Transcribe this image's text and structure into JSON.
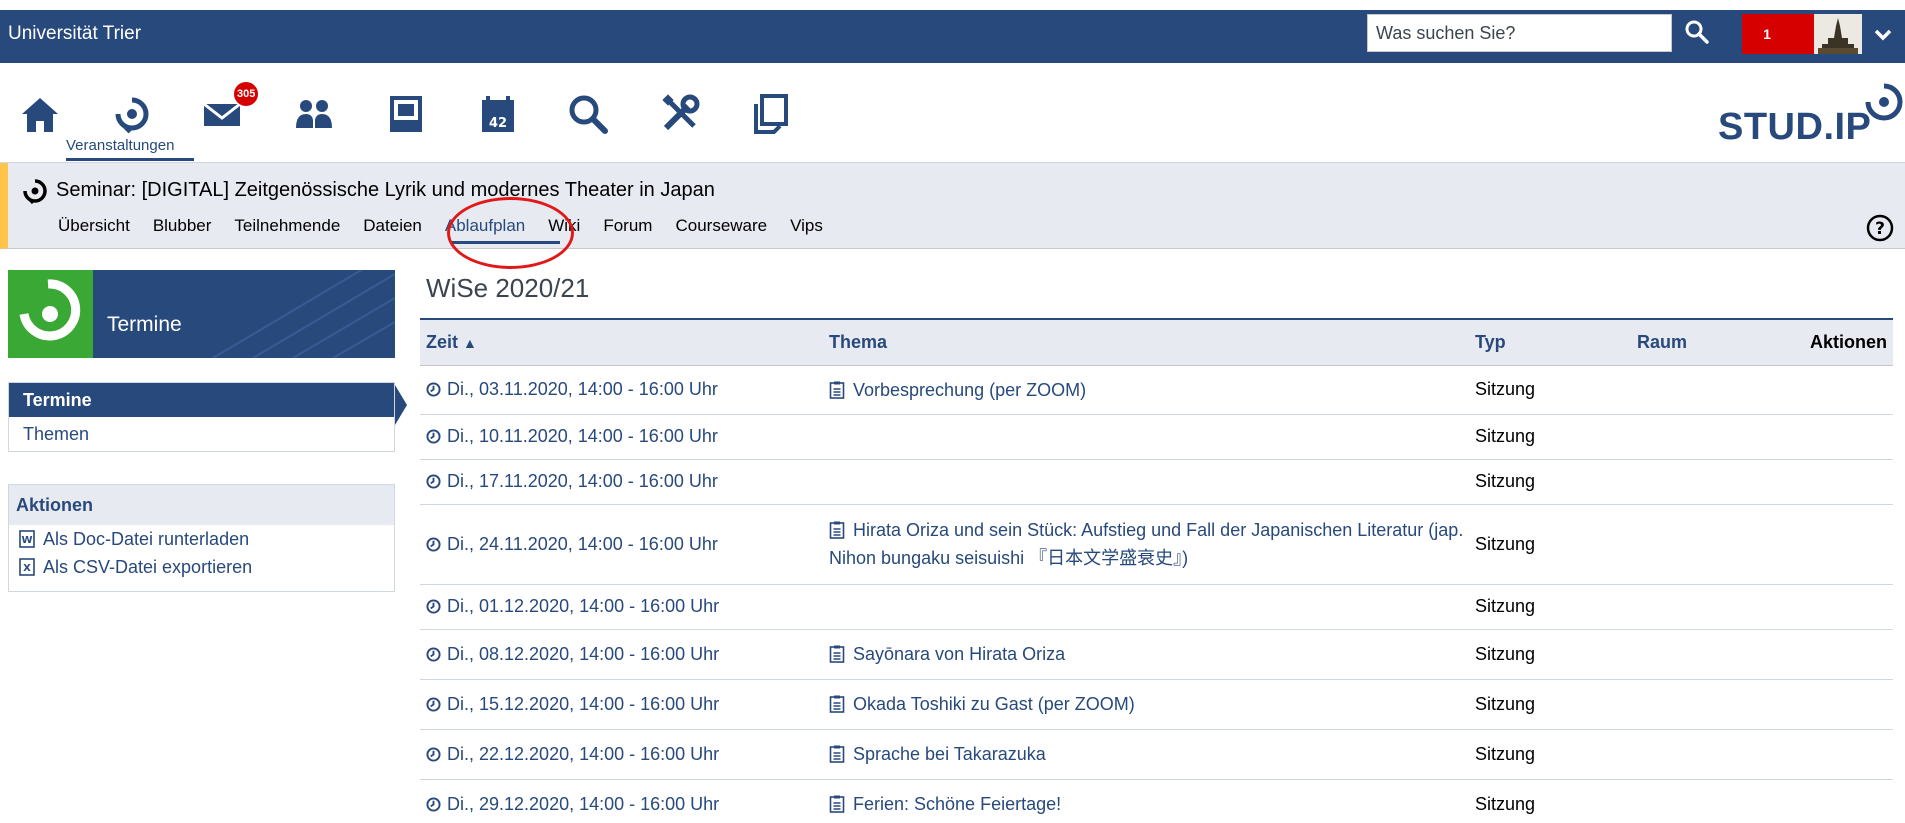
{
  "header": {
    "brand": "Universität Trier",
    "search_placeholder": "Was suchen Sie?",
    "notification_count": "1"
  },
  "iconnav": {
    "mail_badge": "305",
    "active_label": "Veranstaltungen",
    "logo_text": "STUD.IP"
  },
  "course": {
    "title": "Seminar: [DIGITAL] Zeitgenössische Lyrik und modernes Theater in Japan",
    "tabs": [
      "Übersicht",
      "Blubber",
      "Teilnehmende",
      "Dateien",
      "Ablaufplan",
      "Wiki",
      "Forum",
      "Courseware",
      "Vips"
    ],
    "active_tab": "Ablaufplan"
  },
  "sidebar": {
    "title": "Termine",
    "nav": [
      "Termine",
      "Themen"
    ],
    "actions_title": "Aktionen",
    "actions": [
      "Als Doc-Datei runterladen",
      "Als CSV-Datei exportieren"
    ]
  },
  "main": {
    "semester": "WiSe 2020/21",
    "columns": {
      "zeit": "Zeit",
      "thema": "Thema",
      "typ": "Typ",
      "raum": "Raum",
      "aktionen": "Aktionen"
    },
    "rows": [
      {
        "zeit": "Di., 03.11.2020, 14:00 - 16:00 Uhr",
        "thema": "Vorbesprechung (per ZOOM)",
        "typ": "Sitzung",
        "raum": ""
      },
      {
        "zeit": "Di., 10.11.2020, 14:00 - 16:00 Uhr",
        "thema": "",
        "typ": "Sitzung",
        "raum": ""
      },
      {
        "zeit": "Di., 17.11.2020, 14:00 - 16:00 Uhr",
        "thema": "",
        "typ": "Sitzung",
        "raum": ""
      },
      {
        "zeit": "Di., 24.11.2020, 14:00 - 16:00 Uhr",
        "thema": "Hirata Oriza und sein Stück: Aufstieg und Fall der Japanischen Literatur (jap. Nihon bungaku seisuishi 『日本文学盛衰史』)",
        "typ": "Sitzung",
        "raum": ""
      },
      {
        "zeit": "Di., 01.12.2020, 14:00 - 16:00 Uhr",
        "thema": "",
        "typ": "Sitzung",
        "raum": ""
      },
      {
        "zeit": "Di., 08.12.2020, 14:00 - 16:00 Uhr",
        "thema": "Sayōnara von Hirata Oriza",
        "typ": "Sitzung",
        "raum": ""
      },
      {
        "zeit": "Di., 15.12.2020, 14:00 - 16:00 Uhr",
        "thema": "Okada Toshiki zu Gast (per ZOOM)",
        "typ": "Sitzung",
        "raum": ""
      },
      {
        "zeit": "Di., 22.12.2020, 14:00 - 16:00 Uhr",
        "thema": "Sprache bei Takarazuka",
        "typ": "Sitzung",
        "raum": ""
      },
      {
        "zeit": "Di., 29.12.2020, 14:00 - 16:00 Uhr",
        "thema": "Ferien: Schöne Feiertage!",
        "typ": "Sitzung",
        "raum": ""
      }
    ]
  },
  "colors": {
    "primary": "#28497c",
    "accent_red": "#d60000",
    "context_bg": "#e7ebf1",
    "context_border": "#ffc54a",
    "logo_green": "#3aa835",
    "annotation": "#e21818"
  },
  "icons": {
    "nav": [
      "home-icon",
      "courses-icon",
      "mail-icon",
      "community-icon",
      "profile-icon",
      "calendar-icon",
      "search-icon",
      "tools-icon",
      "files-icon"
    ]
  }
}
